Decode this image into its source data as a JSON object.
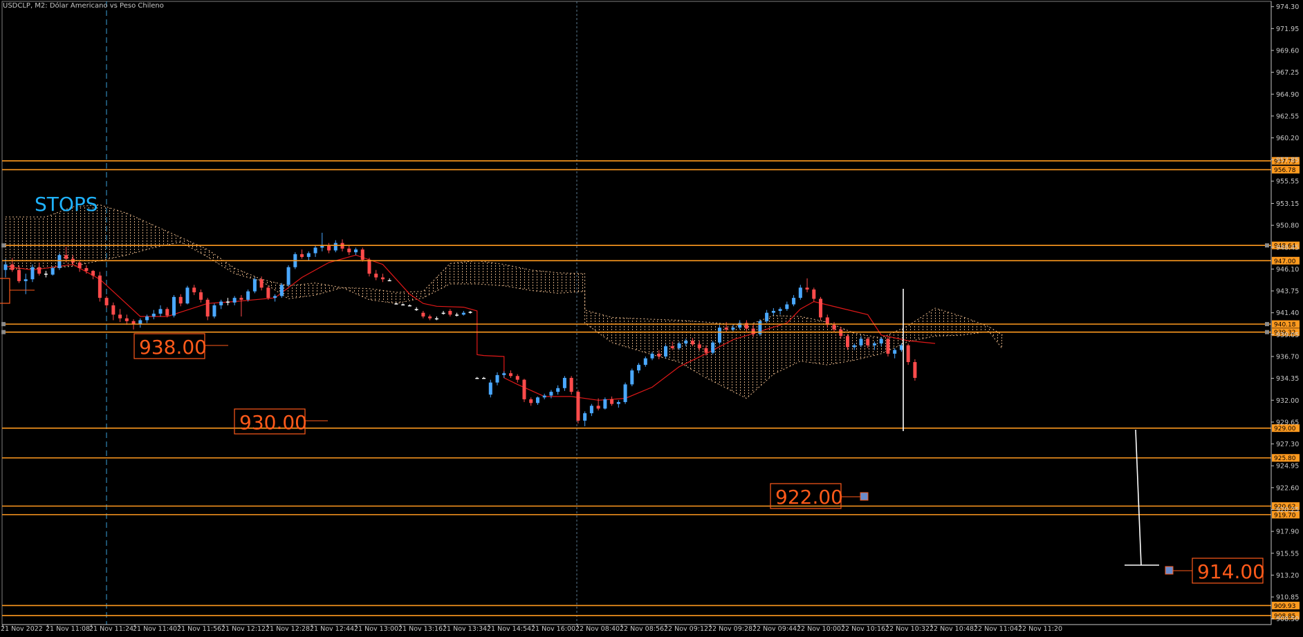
{
  "window": {
    "title": "USDCLP, M2:  Dólar Americano vs Peso Chileno"
  },
  "colors": {
    "background": "#000000",
    "grid_axis": "#c8c8c8",
    "level_line": "#ff9a1f",
    "label_text": "#ff5a1a",
    "stops_text": "#1fb3ff",
    "bull_candle": "#4aa8ff",
    "bear_candle": "#ff4b4b",
    "tenkan": "#e01818",
    "kumo": "#e8b88a",
    "vline": "#3aa0d8",
    "projection": "#ffffff",
    "marker": "#6a8ccc"
  },
  "chart_data": {
    "type": "candlestick",
    "symbol": "USDCLP",
    "timeframe": "M2",
    "y_range": [
      907.5,
      974.5
    ],
    "y_ticks": [
      "974.30",
      "971.95",
      "969.60",
      "967.25",
      "964.90",
      "962.55",
      "960.20",
      "957.85",
      "955.55",
      "953.15",
      "950.80",
      "948.45",
      "946.10",
      "943.75",
      "941.40",
      "939.05",
      "936.70",
      "934.35",
      "932.00",
      "929.65",
      "927.30",
      "924.95",
      "922.60",
      "920.25",
      "917.90",
      "915.55",
      "913.20",
      "910.85",
      "908.50"
    ],
    "x_ticks": [
      "21 Nov 2022",
      "21 Nov 11:08",
      "21 Nov 11:24",
      "21 Nov 11:40",
      "21 Nov 11:56",
      "21 Nov 12:12",
      "21 Nov 12:28",
      "21 Nov 12:44",
      "21 Nov 13:00",
      "21 Nov 13:16",
      "21 Nov 13:34",
      "21 Nov 14:54",
      "21 Nov 16:00",
      "22 Nov 08:40",
      "22 Nov 08:56",
      "22 Nov 09:12",
      "22 Nov 09:28",
      "22 Nov 09:44",
      "22 Nov 10:00",
      "22 Nov 10:16",
      "22 Nov 10:32",
      "22 Nov 10:48",
      "22 Nov 11:04",
      "22 Nov 11:20"
    ],
    "horizontal_levels": [
      {
        "price": 957.73,
        "label": "957.73"
      },
      {
        "price": 956.78,
        "label": "956.78"
      },
      {
        "price": 948.64,
        "label": "948.64"
      },
      {
        "price": 947.0,
        "label": "947.00"
      },
      {
        "price": 940.18,
        "label": "940.18"
      },
      {
        "price": 939.32,
        "label": "939.32"
      },
      {
        "price": 929.0,
        "label": "929.00"
      },
      {
        "price": 925.8,
        "label": "925.80"
      },
      {
        "price": 920.62,
        "label": "920.62"
      },
      {
        "price": 919.7,
        "label": "919.70"
      },
      {
        "price": 909.93,
        "label": "909.93"
      },
      {
        "price": 908.85,
        "label": "908.85"
      }
    ],
    "annotations": [
      {
        "text": "938.00",
        "price": 938.0
      },
      {
        "text": "930.00",
        "price": 930.0
      },
      {
        "text": "922.00",
        "price": 922.0
      },
      {
        "text": "914.00",
        "price": 914.0
      },
      {
        "text": "STOPS"
      }
    ],
    "candles": [
      [
        946.0,
        947.2,
        945.2,
        946.6
      ],
      [
        946.6,
        947.3,
        945.8,
        946.0
      ],
      [
        946.0,
        946.5,
        944.6,
        944.8
      ],
      [
        944.8,
        945.6,
        943.4,
        945.0
      ],
      [
        945.0,
        946.6,
        944.7,
        946.3
      ],
      [
        946.3,
        946.8,
        945.4,
        945.6
      ],
      [
        945.6,
        945.9,
        945.2,
        945.5
      ],
      [
        945.5,
        946.4,
        945.4,
        946.2
      ],
      [
        946.2,
        947.8,
        946.0,
        947.6
      ],
      [
        947.6,
        948.5,
        946.8,
        947.2
      ],
      [
        947.2,
        947.6,
        946.5,
        946.8
      ],
      [
        946.8,
        947.0,
        945.8,
        946.2
      ],
      [
        946.2,
        946.5,
        945.6,
        945.9
      ],
      [
        945.9,
        946.0,
        945.0,
        945.4
      ],
      [
        945.4,
        945.8,
        942.6,
        943.0
      ],
      [
        943.0,
        943.2,
        941.9,
        942.2
      ],
      [
        942.2,
        942.5,
        940.6,
        941.2
      ],
      [
        941.2,
        941.8,
        940.4,
        940.8
      ],
      [
        940.8,
        941.2,
        940.1,
        940.5
      ],
      [
        940.5,
        940.7,
        939.6,
        940.2
      ],
      [
        940.2,
        940.8,
        939.8,
        940.6
      ],
      [
        940.6,
        941.2,
        940.3,
        941.0
      ],
      [
        941.0,
        941.7,
        940.7,
        941.3
      ],
      [
        941.3,
        942.2,
        941.0,
        941.8
      ],
      [
        941.8,
        942.0,
        940.9,
        941.1
      ],
      [
        941.1,
        943.3,
        940.9,
        943.1
      ],
      [
        943.1,
        943.4,
        942.1,
        942.4
      ],
      [
        942.4,
        944.3,
        942.3,
        944.1
      ],
      [
        944.1,
        944.4,
        943.3,
        943.6
      ],
      [
        943.6,
        943.9,
        942.5,
        942.8
      ],
      [
        942.8,
        943.0,
        940.6,
        941.0
      ],
      [
        941.0,
        942.4,
        940.8,
        942.2
      ],
      [
        942.2,
        942.8,
        941.8,
        942.6
      ],
      [
        942.6,
        943.0,
        942.2,
        942.5
      ],
      [
        942.5,
        943.2,
        942.2,
        943.0
      ],
      [
        943.0,
        943.3,
        941.0,
        942.8
      ],
      [
        942.8,
        943.9,
        942.6,
        943.7
      ],
      [
        943.7,
        945.2,
        943.5,
        945.0
      ],
      [
        945.0,
        945.3,
        943.8,
        944.1
      ],
      [
        944.1,
        944.3,
        942.8,
        943.0
      ],
      [
        943.0,
        943.4,
        942.6,
        943.2
      ],
      [
        943.2,
        944.6,
        943.0,
        944.4
      ],
      [
        944.4,
        946.5,
        944.2,
        946.3
      ],
      [
        946.3,
        947.9,
        946.1,
        947.7
      ],
      [
        947.7,
        948.2,
        947.2,
        947.4
      ],
      [
        947.4,
        948.0,
        947.0,
        947.8
      ],
      [
        947.8,
        948.6,
        947.4,
        948.4
      ],
      [
        948.4,
        950.0,
        948.0,
        948.6
      ],
      [
        948.6,
        948.9,
        947.8,
        948.1
      ],
      [
        948.1,
        949.2,
        947.9,
        948.9
      ],
      [
        948.9,
        949.3,
        948.0,
        948.3
      ],
      [
        948.3,
        948.6,
        947.6,
        947.9
      ],
      [
        947.9,
        948.4,
        947.6,
        948.2
      ],
      [
        948.2,
        948.4,
        946.9,
        947.1
      ],
      [
        947.1,
        947.3,
        945.3,
        945.6
      ],
      [
        945.6,
        946.0,
        944.9,
        945.2
      ],
      [
        945.2,
        945.6,
        944.7,
        945.0
      ],
      [
        944.9,
        945.1,
        944.8,
        944.9
      ],
      [
        942.4,
        942.5,
        942.3,
        942.4
      ],
      [
        942.3,
        942.4,
        942.2,
        942.3
      ],
      [
        942.2,
        942.3,
        942.1,
        942.2
      ],
      [
        941.8,
        942.0,
        941.6,
        941.8
      ],
      [
        941.4,
        941.6,
        940.8,
        941.0
      ],
      [
        941.0,
        941.2,
        940.6,
        940.8
      ],
      [
        940.8,
        941.0,
        940.6,
        940.8
      ],
      [
        941.4,
        941.6,
        941.2,
        941.4
      ],
      [
        941.6,
        941.8,
        941.0,
        941.2
      ],
      [
        941.2,
        941.4,
        941.0,
        941.2
      ],
      [
        941.2,
        941.6,
        941.1,
        941.4
      ],
      [
        941.4,
        941.6,
        941.3,
        941.5
      ],
      [
        934.4,
        934.5,
        934.3,
        934.4
      ],
      [
        934.4,
        934.5,
        934.3,
        934.4
      ],
      [
        932.6,
        934.2,
        932.3,
        933.9
      ],
      [
        933.9,
        935.0,
        933.6,
        934.7
      ],
      [
        934.7,
        935.1,
        934.4,
        934.9
      ],
      [
        934.9,
        935.2,
        934.4,
        934.6
      ],
      [
        934.6,
        934.8,
        933.9,
        934.2
      ],
      [
        934.2,
        934.3,
        931.8,
        932.1
      ],
      [
        932.1,
        932.3,
        931.4,
        931.7
      ],
      [
        931.7,
        932.4,
        931.5,
        932.3
      ],
      [
        932.3,
        932.7,
        932.1,
        932.5
      ],
      [
        932.5,
        933.1,
        932.2,
        932.9
      ],
      [
        932.9,
        933.6,
        932.6,
        933.3
      ],
      [
        933.3,
        934.6,
        933.0,
        934.4
      ],
      [
        934.4,
        934.6,
        932.6,
        932.9
      ],
      [
        932.9,
        933.1,
        929.5,
        929.8
      ],
      [
        929.8,
        930.8,
        929.2,
        930.6
      ],
      [
        930.6,
        931.6,
        930.3,
        931.4
      ],
      [
        931.4,
        932.2,
        930.9,
        931.1
      ],
      [
        931.1,
        932.3,
        931.0,
        932.1
      ],
      [
        932.1,
        932.4,
        931.4,
        931.6
      ],
      [
        931.6,
        932.0,
        931.2,
        931.8
      ],
      [
        931.8,
        933.9,
        931.6,
        933.7
      ],
      [
        933.7,
        935.4,
        933.5,
        935.2
      ],
      [
        935.2,
        936.0,
        934.9,
        935.8
      ],
      [
        935.8,
        936.7,
        935.6,
        936.5
      ],
      [
        936.5,
        937.2,
        936.3,
        937.0
      ],
      [
        937.0,
        937.4,
        936.4,
        936.7
      ],
      [
        936.7,
        938.0,
        936.5,
        937.8
      ],
      [
        937.8,
        938.3,
        937.4,
        937.6
      ],
      [
        937.6,
        938.3,
        937.4,
        938.1
      ],
      [
        938.1,
        938.6,
        937.8,
        938.4
      ],
      [
        938.4,
        938.7,
        937.8,
        938.0
      ],
      [
        938.0,
        938.4,
        937.3,
        937.6
      ],
      [
        937.6,
        937.9,
        936.8,
        937.1
      ],
      [
        937.1,
        938.4,
        936.9,
        938.2
      ],
      [
        938.2,
        940.1,
        938.0,
        939.8
      ],
      [
        939.8,
        940.4,
        939.3,
        939.6
      ],
      [
        939.6,
        940.1,
        939.4,
        939.8
      ],
      [
        939.8,
        940.6,
        939.6,
        940.3
      ],
      [
        940.3,
        940.6,
        939.4,
        939.7
      ],
      [
        939.7,
        940.2,
        938.8,
        939.1
      ],
      [
        939.1,
        940.7,
        938.9,
        940.5
      ],
      [
        940.5,
        941.7,
        940.3,
        941.4
      ],
      [
        941.4,
        941.9,
        941.1,
        941.6
      ],
      [
        941.6,
        942.0,
        941.2,
        941.8
      ],
      [
        941.8,
        942.6,
        941.6,
        942.3
      ],
      [
        942.3,
        943.3,
        942.1,
        943.0
      ],
      [
        943.0,
        944.4,
        942.8,
        944.1
      ],
      [
        944.1,
        945.1,
        943.6,
        943.9
      ],
      [
        943.9,
        944.1,
        942.6,
        942.9
      ],
      [
        942.9,
        943.1,
        940.6,
        940.9
      ],
      [
        940.9,
        941.2,
        939.8,
        940.1
      ],
      [
        940.1,
        940.4,
        939.3,
        939.6
      ],
      [
        939.6,
        939.9,
        938.6,
        938.9
      ],
      [
        938.9,
        939.1,
        937.4,
        937.7
      ],
      [
        937.7,
        938.1,
        937.4,
        937.9
      ],
      [
        937.9,
        938.9,
        937.7,
        938.6
      ],
      [
        938.6,
        938.8,
        937.6,
        937.9
      ],
      [
        937.9,
        938.3,
        937.4,
        938.1
      ],
      [
        938.1,
        938.8,
        937.8,
        938.6
      ],
      [
        938.6,
        938.8,
        936.7,
        937.0
      ],
      [
        937.0,
        937.6,
        936.5,
        937.4
      ],
      [
        937.4,
        938.1,
        937.2,
        937.9
      ],
      [
        937.9,
        938.1,
        935.8,
        936.1
      ],
      [
        936.1,
        936.4,
        934.1,
        934.4
      ]
    ],
    "tenkan": [
      [
        0,
        946.4
      ],
      [
        4,
        946.0
      ],
      [
        10,
        946.6
      ],
      [
        14,
        945.0
      ],
      [
        17,
        943.0
      ],
      [
        20,
        941.0
      ],
      [
        24,
        941.0
      ],
      [
        30,
        942.4
      ],
      [
        34,
        942.6
      ],
      [
        40,
        943.0
      ],
      [
        44,
        945.2
      ],
      [
        48,
        946.8
      ],
      [
        52,
        947.6
      ],
      [
        56,
        946.6
      ],
      [
        58,
        945.0
      ],
      [
        60,
        943.4
      ],
      [
        62,
        942.4
      ],
      [
        64,
        942.1
      ],
      [
        68,
        942.0
      ],
      [
        70,
        941.6
      ],
      [
        70,
        936.9
      ],
      [
        71,
        936.8
      ],
      [
        74,
        936.7
      ],
      [
        74,
        934.4
      ],
      [
        76,
        933.7
      ],
      [
        80,
        932.4
      ],
      [
        84,
        932.4
      ],
      [
        88,
        932.0
      ],
      [
        92,
        932.2
      ],
      [
        96,
        933.4
      ],
      [
        100,
        935.6
      ],
      [
        104,
        937.0
      ],
      [
        108,
        938.5
      ],
      [
        112,
        939.4
      ],
      [
        116,
        940.3
      ],
      [
        118,
        941.8
      ],
      [
        120,
        942.6
      ],
      [
        124,
        941.9
      ],
      [
        128,
        941.2
      ],
      [
        130,
        939.0
      ],
      [
        134,
        938.4
      ],
      [
        138,
        938.1
      ]
    ],
    "kumo_top": [
      [
        0,
        951.7
      ],
      [
        6,
        951.7
      ],
      [
        10,
        952.8
      ],
      [
        14,
        953.0
      ],
      [
        18,
        952.1
      ],
      [
        22,
        950.8
      ],
      [
        26,
        949.5
      ],
      [
        30,
        948.2
      ],
      [
        34,
        946.2
      ],
      [
        38,
        945.0
      ],
      [
        42,
        944.3
      ],
      [
        46,
        944.6
      ],
      [
        50,
        944.1
      ],
      [
        54,
        944.0
      ],
      [
        58,
        943.6
      ],
      [
        62,
        943.7
      ],
      [
        66,
        946.7
      ],
      [
        70,
        947.0
      ],
      [
        74,
        946.6
      ],
      [
        78,
        946.0
      ],
      [
        82,
        945.7
      ],
      [
        86,
        945.6
      ],
      [
        86,
        941.7
      ],
      [
        90,
        940.9
      ],
      [
        96,
        940.7
      ],
      [
        100,
        940.6
      ],
      [
        104,
        940.4
      ],
      [
        110,
        940.0
      ],
      [
        114,
        941.1
      ],
      [
        118,
        941.0
      ],
      [
        122,
        940.4
      ],
      [
        126,
        939.2
      ],
      [
        130,
        938.7
      ],
      [
        134,
        940.0
      ],
      [
        138,
        941.9
      ],
      [
        142,
        941.0
      ],
      [
        146,
        939.9
      ],
      [
        148,
        939.0
      ]
    ],
    "kumo_bottom": [
      [
        0,
        946.1
      ],
      [
        6,
        946.2
      ],
      [
        10,
        946.4
      ],
      [
        14,
        947.0
      ],
      [
        18,
        947.6
      ],
      [
        22,
        948.4
      ],
      [
        26,
        949.0
      ],
      [
        30,
        947.4
      ],
      [
        34,
        945.6
      ],
      [
        38,
        944.8
      ],
      [
        42,
        942.9
      ],
      [
        46,
        943.3
      ],
      [
        50,
        944.1
      ],
      [
        54,
        942.8
      ],
      [
        58,
        942.4
      ],
      [
        62,
        943.0
      ],
      [
        66,
        944.5
      ],
      [
        70,
        944.5
      ],
      [
        74,
        944.3
      ],
      [
        78,
        943.8
      ],
      [
        82,
        943.5
      ],
      [
        86,
        943.7
      ],
      [
        86,
        940.3
      ],
      [
        90,
        938.2
      ],
      [
        96,
        936.9
      ],
      [
        100,
        936.1
      ],
      [
        104,
        934.4
      ],
      [
        110,
        932.2
      ],
      [
        114,
        934.8
      ],
      [
        118,
        936.2
      ],
      [
        122,
        935.8
      ],
      [
        126,
        936.3
      ],
      [
        130,
        937.0
      ],
      [
        134,
        938.3
      ],
      [
        138,
        938.9
      ],
      [
        142,
        939.0
      ],
      [
        146,
        939.4
      ],
      [
        148,
        937.5
      ]
    ]
  }
}
